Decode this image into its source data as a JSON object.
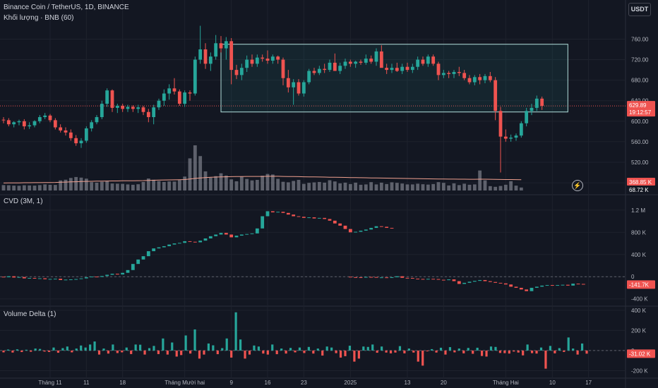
{
  "header": {
    "main_legend": "Binance Coin / TetherUS, 1D, BINANCE",
    "volume_legend": "Khối lượng · BNB (60)",
    "cvd_legend": "CVD (3M, 1)",
    "delta_legend": "Volume Delta (1)",
    "currency": "USDT"
  },
  "colors": {
    "background": "#131722",
    "up": "#26a69a",
    "down": "#ef5350",
    "volume": "#787b86",
    "volume_ma": "#f0a08f",
    "box_border": "#b2dfdb",
    "box_fill": "#26a69a",
    "grid": "#1e222d",
    "separator": "#2a2e39",
    "label_text": "#b2b5be"
  },
  "labels": {
    "price_tag": "629.89",
    "countdown": "19:12:57",
    "volume_tag": "368.85 K",
    "volume_tag2": "68.72 K",
    "cvd_tag": "-141.7K",
    "delta_tag": "-31.02 K"
  },
  "chart_data": [
    {
      "type": "candlestick",
      "title": "Binance Coin / TetherUS, 1D, BINANCE",
      "ylim": [
        465,
        795
      ],
      "y_ticks": [
        480,
        520,
        560,
        600,
        640,
        680,
        720,
        760
      ],
      "x_ticks": [
        {
          "day": 4,
          "label": "Tháng 11"
        },
        {
          "day": 11,
          "label": "11"
        },
        {
          "day": 18,
          "label": "18"
        },
        {
          "day": 30,
          "label": "Tháng Mười hai"
        },
        {
          "day": 39,
          "label": "9"
        },
        {
          "day": 46,
          "label": "16"
        },
        {
          "day": 53,
          "label": "23"
        },
        {
          "day": 62,
          "label": "2025"
        },
        {
          "day": 73,
          "label": "13"
        },
        {
          "day": 80,
          "label": "20"
        },
        {
          "day": 92,
          "label": "Tháng Hai"
        },
        {
          "day": 101,
          "label": "10"
        },
        {
          "day": 108,
          "label": "17"
        }
      ],
      "x_range": [
        -5,
        106
      ],
      "last_price": 629.89,
      "range_box": {
        "day_start": 37,
        "day_end": 104,
        "top": 750,
        "bottom": 618
      },
      "ohlc": [
        [
          603,
          608,
          596,
          602
        ],
        [
          602,
          606,
          590,
          594
        ],
        [
          594,
          600,
          588,
          598
        ],
        [
          598,
          603,
          592,
          600
        ],
        [
          600,
          604,
          584,
          590
        ],
        [
          590,
          598,
          585,
          592
        ],
        [
          592,
          602,
          588,
          600
        ],
        [
          600,
          612,
          596,
          608
        ],
        [
          608,
          616,
          604,
          611
        ],
        [
          611,
          614,
          598,
          602
        ],
        [
          602,
          606,
          584,
          588
        ],
        [
          588,
          594,
          578,
          582
        ],
        [
          582,
          588,
          572,
          578
        ],
        [
          578,
          584,
          562,
          567
        ],
        [
          567,
          573,
          552,
          557
        ],
        [
          557,
          567,
          548,
          562
        ],
        [
          562,
          590,
          558,
          586
        ],
        [
          586,
          602,
          580,
          598
        ],
        [
          598,
          612,
          594,
          608
        ],
        [
          608,
          640,
          604,
          634
        ],
        [
          634,
          664,
          628,
          660
        ],
        [
          660,
          662,
          618,
          626
        ],
        [
          626,
          634,
          616,
          630
        ],
        [
          630,
          634,
          618,
          624
        ],
        [
          624,
          632,
          618,
          628
        ],
        [
          628,
          631,
          618,
          624
        ],
        [
          624,
          632,
          616,
          627
        ],
        [
          627,
          630,
          612,
          618
        ],
        [
          618,
          624,
          598,
          608
        ],
        [
          608,
          632,
          594,
          627
        ],
        [
          627,
          644,
          622,
          640
        ],
        [
          640,
          662,
          630,
          654
        ],
        [
          654,
          672,
          642,
          664
        ],
        [
          664,
          684,
          652,
          658
        ],
        [
          658,
          662,
          630,
          634
        ],
        [
          634,
          660,
          628,
          656
        ],
        [
          656,
          660,
          640,
          654
        ],
        [
          654,
          726,
          650,
          720
        ],
        [
          720,
          786,
          712,
          740
        ],
        [
          740,
          752,
          702,
          712
        ],
        [
          712,
          734,
          698,
          726
        ],
        [
          726,
          768,
          720,
          752
        ],
        [
          752,
          766,
          734,
          742
        ],
        [
          742,
          764,
          720,
          756
        ],
        [
          756,
          762,
          672,
          700
        ],
        [
          700,
          710,
          682,
          690
        ],
        [
          690,
          712,
          680,
          704
        ],
        [
          704,
          728,
          696,
          720
        ],
        [
          720,
          730,
          706,
          712
        ],
        [
          712,
          730,
          706,
          724
        ],
        [
          724,
          730,
          716,
          722
        ],
        [
          722,
          738,
          712,
          718
        ],
        [
          718,
          730,
          712,
          726
        ],
        [
          726,
          728,
          712,
          720
        ],
        [
          720,
          724,
          670,
          684
        ],
        [
          684,
          700,
          656,
          666
        ],
        [
          666,
          682,
          632,
          676
        ],
        [
          676,
          682,
          650,
          654
        ],
        [
          654,
          680,
          648,
          676
        ],
        [
          676,
          702,
          672,
          698
        ],
        [
          698,
          704,
          690,
          694
        ],
        [
          694,
          708,
          690,
          702
        ],
        [
          702,
          712,
          694,
          700
        ],
        [
          700,
          720,
          696,
          714
        ],
        [
          714,
          732,
          706,
          698
        ],
        [
          698,
          714,
          692,
          708
        ],
        [
          708,
          722,
          702,
          716
        ],
        [
          716,
          720,
          706,
          712
        ],
        [
          712,
          718,
          704,
          716
        ],
        [
          716,
          720,
          710,
          714
        ],
        [
          714,
          730,
          710,
          722
        ],
        [
          722,
          728,
          712,
          716
        ],
        [
          716,
          742,
          708,
          736
        ],
        [
          736,
          748,
          716,
          704
        ],
        [
          704,
          712,
          692,
          700
        ],
        [
          700,
          712,
          694,
          704
        ],
        [
          704,
          714,
          696,
          698
        ],
        [
          698,
          712,
          692,
          706
        ],
        [
          706,
          714,
          696,
          700
        ],
        [
          700,
          712,
          694,
          706
        ],
        [
          706,
          726,
          700,
          720
        ],
        [
          720,
          726,
          708,
          712
        ],
        [
          712,
          730,
          706,
          726
        ],
        [
          726,
          730,
          708,
          712
        ],
        [
          712,
          716,
          680,
          690
        ],
        [
          690,
          700,
          684,
          694
        ],
        [
          694,
          698,
          684,
          692
        ],
        [
          692,
          700,
          684,
          696
        ],
        [
          696,
          706,
          688,
          694
        ],
        [
          694,
          700,
          680,
          684
        ],
        [
          684,
          690,
          672,
          676
        ],
        [
          676,
          690,
          670,
          686
        ],
        [
          686,
          692,
          672,
          680
        ],
        [
          680,
          692,
          674,
          688
        ],
        [
          688,
          696,
          676,
          680
        ],
        [
          680,
          686,
          602,
          620
        ],
        [
          620,
          628,
          500,
          570
        ],
        [
          570,
          584,
          560,
          566
        ],
        [
          566,
          574,
          560,
          568
        ],
        [
          568,
          576,
          562,
          572
        ],
        [
          572,
          600,
          568,
          596
        ],
        [
          596,
          626,
          590,
          620
        ],
        [
          620,
          634,
          612,
          626
        ],
        [
          626,
          650,
          620,
          644
        ],
        [
          644,
          648,
          622,
          630
        ]
      ],
      "volume": [
        {
          "ylim": [
            0,
            5200000
          ]
        },
        [
          620,
          600,
          560,
          540,
          600,
          580,
          560,
          620,
          700,
          650,
          640,
          1160,
          1240,
          1440,
          1550,
          1480,
          1360,
          960,
          900,
          1000,
          1100,
          800,
          780,
          760,
          700,
          660,
          720,
          980,
          1380,
          1240,
          1080,
          980,
          1040,
          1020,
          1200,
          1600,
          3700,
          5200,
          3960,
          2200,
          1480,
          1650,
          1980,
          1720,
          1280,
          1060,
          1580,
          1330,
          1160,
          1220,
          1700,
          1900,
          1840,
          1340,
          1000,
          940,
          1100,
          1220,
          760,
          880,
          930,
          980,
          900,
          1180,
          1040,
          820,
          900,
          740,
          900,
          660,
          700,
          960,
          700,
          900,
          740,
          940,
          880,
          800,
          700,
          700,
          780,
          720,
          680,
          740,
          960,
          880,
          580,
          820,
          620,
          780,
          660,
          700,
          2300,
          1170,
          500,
          420,
          520,
          660,
          1070,
          560,
          340
        ],
        [
          860,
          870,
          880,
          880,
          890,
          890,
          900,
          900,
          910,
          920,
          930,
          950,
          970,
          990,
          1010,
          1030,
          1050,
          1060,
          1070,
          1080,
          1090,
          1100,
          1100,
          1110,
          1110,
          1120,
          1130,
          1140,
          1160,
          1180,
          1200,
          1210,
          1220,
          1230,
          1240,
          1260,
          1320,
          1390,
          1450,
          1490,
          1520,
          1540,
          1560,
          1580,
          1590,
          1600,
          1610,
          1620,
          1620,
          1620,
          1620,
          1630,
          1630,
          1630,
          1620,
          1610,
          1600,
          1590,
          1580,
          1570,
          1560,
          1550,
          1540,
          1530,
          1520,
          1510,
          1500,
          1490,
          1480,
          1470,
          1460,
          1450,
          1440,
          1430,
          1420,
          1410,
          1400,
          1390,
          1380,
          1370,
          1360,
          1350,
          1340,
          1330,
          1320,
          1320,
          1310,
          1310,
          1300,
          1300,
          1290,
          1290,
          1300,
          1300,
          1290,
          1280,
          1270,
          1260,
          1260,
          1250,
          1240
        ]
      ]
    },
    {
      "type": "candlestick",
      "title": "CVD (3M, 1)",
      "ylim": [
        -480000,
        1300000
      ],
      "y_ticks": [
        {
          "v": -400000,
          "label": "-400 K"
        },
        {
          "v": 0,
          "label": "0"
        },
        {
          "v": 400000,
          "label": "400 K"
        },
        {
          "v": 800000,
          "label": "800 K"
        },
        {
          "v": 1200000,
          "label": "1.2 M"
        }
      ],
      "last_value": -141700,
      "segments": [
        {
          "start_day": -5,
          "close": [
            -10,
            8,
            -15,
            -6,
            -30,
            -22,
            -35,
            -28,
            -45,
            -40,
            -36,
            -60,
            -52,
            -48,
            -42,
            -30,
            -10,
            2,
            -4,
            12,
            35,
            54,
            40,
            70,
            120,
            230,
            310,
            370,
            460,
            510,
            530,
            550,
            580,
            600,
            610,
            640,
            630,
            620,
            650,
            690,
            730,
            760,
            790,
            760,
            710,
            740,
            760,
            770,
            780,
            870,
            1090,
            1180,
            1160,
            1170,
            1150,
            1120,
            1090,
            1080,
            1060,
            1070,
            1050,
            1060,
            1040,
            1010,
            960,
            920,
            860,
            800,
            810,
            830,
            850,
            880,
            910,
            900,
            880,
            875
          ]
        },
        {
          "start_day": 62,
          "close": [
            -8,
            -10,
            -12,
            -4,
            -6,
            -15,
            -12,
            -18,
            -10,
            8,
            -20,
            -22,
            -35,
            -40,
            -46,
            -38,
            -42,
            -55,
            -62,
            -48,
            -80,
            -130,
            -110,
            -90,
            -75,
            -60,
            -80,
            -95,
            -110,
            -120,
            -140,
            -180,
            -200,
            -230,
            -260,
            -200,
            -180,
            -160,
            -150,
            -155,
            -150,
            -145,
            -160,
            -125,
            -130,
            -140
          ]
        }
      ]
    },
    {
      "type": "bar",
      "title": "Volume Delta (1)",
      "ylim": [
        -260000,
        420000
      ],
      "y_ticks": [
        {
          "v": -200000,
          "label": "-200 K"
        },
        {
          "v": 0,
          "label": "0"
        },
        {
          "v": 200000,
          "label": "200 K"
        },
        {
          "v": 400000,
          "label": "400 K"
        }
      ],
      "last_value": -31020,
      "start_day": -5,
      "values": [
        -18,
        10,
        -20,
        12,
        -15,
        8,
        -12,
        20,
        16,
        -10,
        -14,
        30,
        -22,
        24,
        40,
        -18,
        20,
        50,
        30,
        60,
        90,
        -40,
        20,
        -30,
        60,
        -25,
        -18,
        30,
        -35,
        60,
        58,
        -40,
        24,
        46,
        -35,
        120,
        -40,
        80,
        -60,
        -45,
        150,
        -30,
        210,
        -80,
        -40,
        70,
        52,
        -36,
        24,
        120,
        -70,
        380,
        110,
        -80,
        -40,
        50,
        40,
        -30,
        -40,
        60,
        -36,
        20,
        -30,
        26,
        -18,
        30,
        -25,
        36,
        -30,
        20,
        -50,
        40,
        30,
        -26,
        -70,
        -56,
        48,
        -110,
        -80,
        40,
        36,
        60,
        -22,
        40,
        -20,
        -28,
        -20,
        44,
        -28,
        20,
        -20,
        -110,
        -150,
        -8,
        14,
        -20,
        28,
        -40,
        34,
        -18,
        20,
        -28,
        26,
        -32,
        28,
        -54,
        -60,
        40,
        36,
        -24,
        -26,
        -30,
        -10,
        -20,
        -48,
        60,
        -26,
        -30,
        30,
        -180,
        46,
        -28,
        24,
        -14,
        130,
        20,
        -40,
        70,
        -31
      ]
    }
  ]
}
